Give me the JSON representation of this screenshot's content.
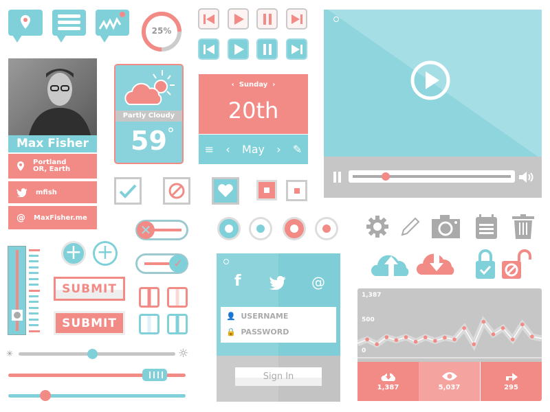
{
  "progress_ring": {
    "label": "25%",
    "value": 25
  },
  "profile": {
    "name": "Max Fisher",
    "location": "Portland OR, Earth",
    "twitter": "mfish",
    "website": "MaxFisher.me"
  },
  "weather": {
    "condition": "Partly Cloudy",
    "temperature": "59",
    "unit": "°"
  },
  "date_widget": {
    "day": "Sunday",
    "date": "20th",
    "month": "May"
  },
  "video": {
    "progress_percent": 15
  },
  "buttons": {
    "submit_outline": "SUBMIT",
    "submit_filled": "SUBMIT"
  },
  "login": {
    "username_placeholder": "USERNAME",
    "password_placeholder": "PASSWORD",
    "sign_in": "Sign In",
    "social": [
      "f",
      "twitter",
      "@"
    ]
  },
  "sliders": {
    "vertical_percent": 20,
    "brightness_percent": 45,
    "coral_percent": 78,
    "teal_percent": 21
  },
  "colors": {
    "teal": "#7fd0d9",
    "coral": "#f28b86",
    "gray": "#c6c6c6"
  },
  "stats": [
    {
      "icon": "cloud-download-icon",
      "value": "1,387"
    },
    {
      "icon": "eye-icon",
      "value": "5,037"
    },
    {
      "icon": "share-icon",
      "value": "295"
    }
  ],
  "chart_data": {
    "type": "line",
    "y_tick_labels": [
      "1,387",
      "500",
      "0"
    ],
    "ylim": [
      0,
      1387
    ],
    "values": [
      210,
      307,
      185,
      363,
      289,
      363,
      248,
      359,
      270,
      352,
      307,
      593,
      185,
      752,
      437,
      593,
      307,
      685,
      378,
      330
    ],
    "grid": false
  }
}
